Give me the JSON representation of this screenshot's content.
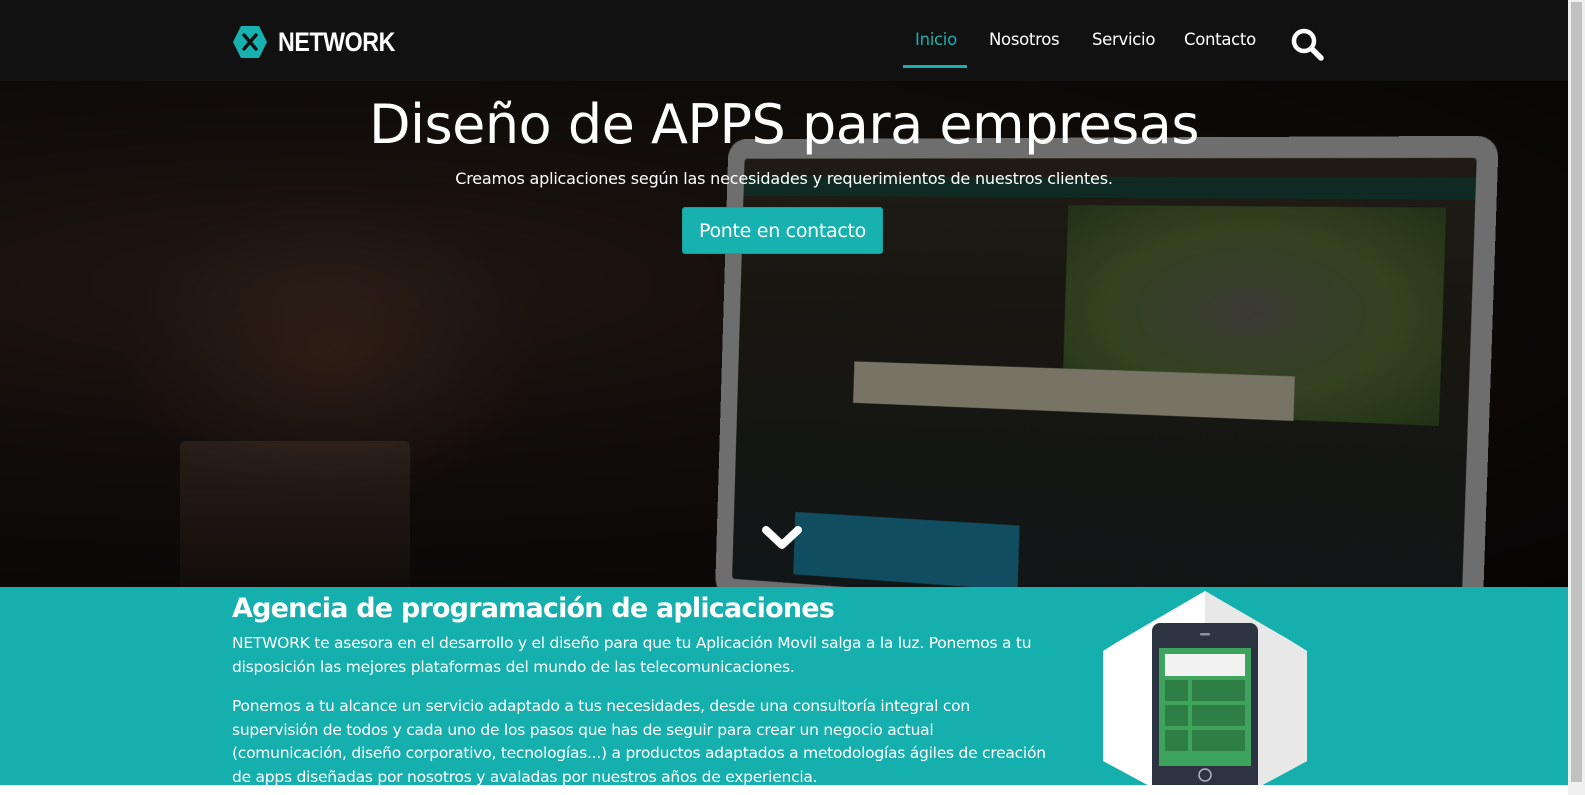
{
  "navbar": {
    "brand": "NETWORK",
    "items": [
      {
        "label": "Inicio",
        "active": true
      },
      {
        "label": "Nosotros",
        "active": false
      },
      {
        "label": "Servicio",
        "active": false
      },
      {
        "label": "Contacto",
        "active": false
      }
    ],
    "search_icon": "search-icon"
  },
  "hero": {
    "title": "Diseño de APPS para empresas",
    "subtitle": "Creamos aplicaciones según las necesidades y requerimientos de nuestros clientes.",
    "cta": "Ponte en contacto",
    "scroll_icon": "chevron-down-icon"
  },
  "about": {
    "title": "Agencia de programación de aplicaciones",
    "p1": "NETWORK te asesora en el desarrollo y el diseño para que tu Aplicación Movil salga a la luz. Ponemos a tu disposición las mejores plataformas del mundo de las telecomunicaciones.",
    "p2": "Ponemos a tu alcance un servicio adaptado a tus necesidades, desde una consultoría integral con supervisión de todos y cada uno de los pasos que has de seguir para crear un negocio actual (comunicación, diseño corporativo, tecnologías...) a productos adaptados a metodologías ágiles de creación de apps diseñadas por nosotros y avaladas por nuestros años de experiencia."
  },
  "colors": {
    "accent": "#17b1b0",
    "navbar_bg": "#111111",
    "section_bg": "#15afae"
  }
}
